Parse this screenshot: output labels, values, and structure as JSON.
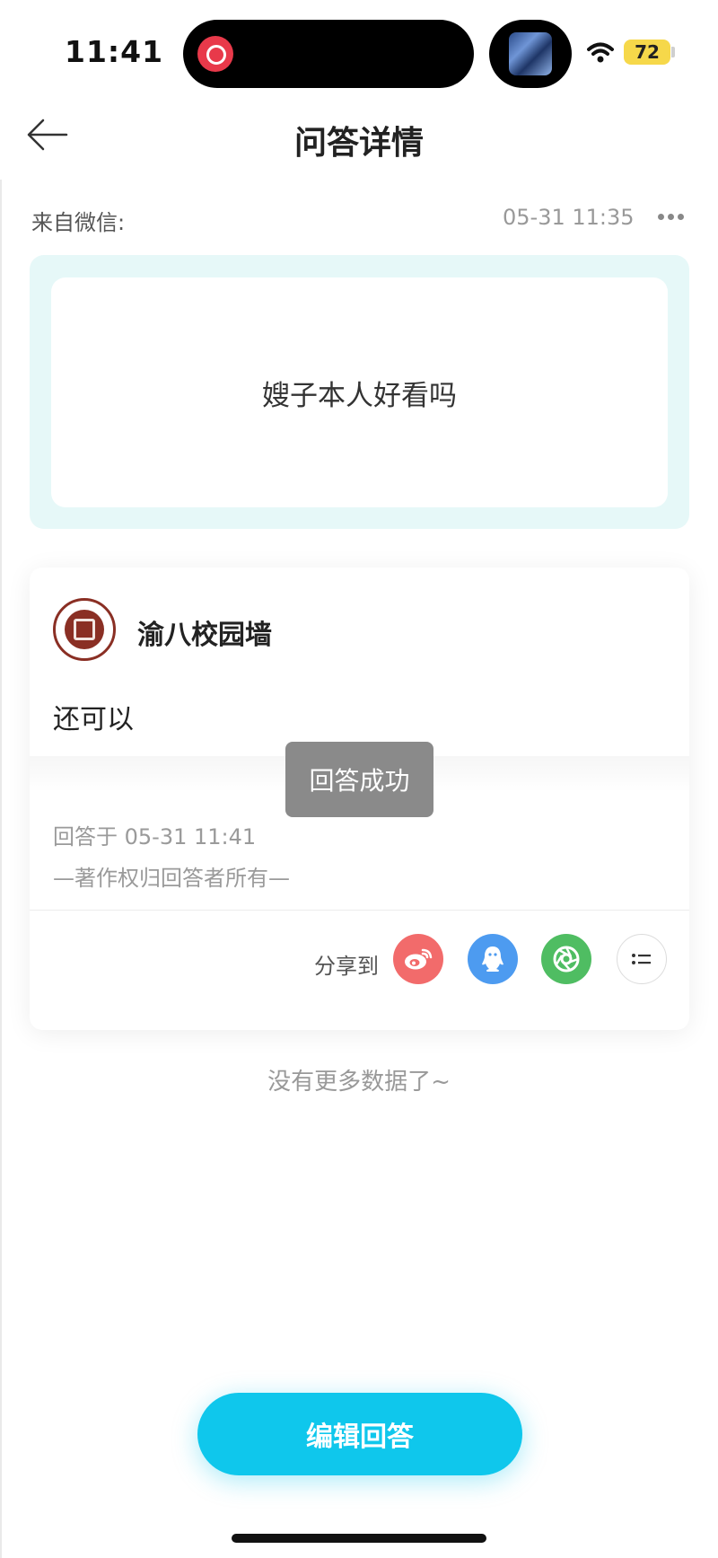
{
  "status_bar": {
    "time": "11:41",
    "battery": "72"
  },
  "nav": {
    "title": "问答详情"
  },
  "question": {
    "source_label": "来自微信:",
    "time": "05-31 11:35",
    "text": "嫂子本人好看吗"
  },
  "answer": {
    "author": "渝八校园墙",
    "text": "还可以",
    "answered_at": "回答于 05-31 11:41",
    "copyright": "—著作权归回答者所有—",
    "share_label": "分享到"
  },
  "share_icons": [
    "weibo-icon",
    "qq-icon",
    "moments-icon",
    "more-list-icon"
  ],
  "colors": {
    "accent": "#0fc7ec",
    "question_bg": "#e6f8f8",
    "weibo": "#f26b6b",
    "qq": "#4d9bf0",
    "moments": "#4fbd62"
  },
  "toast": "回答成功",
  "footer": {
    "no_more": "没有更多数据了~"
  },
  "edit_button": "编辑回答"
}
